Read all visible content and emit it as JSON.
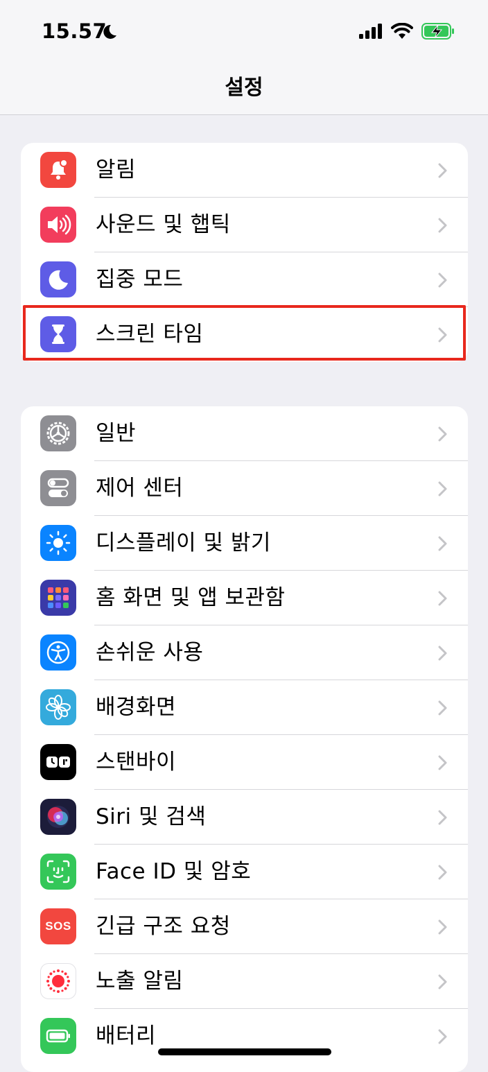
{
  "status_bar": {
    "time": "15.57"
  },
  "nav": {
    "title": "설정"
  },
  "groups": [
    {
      "items": [
        {
          "label": "알림",
          "icon": "bell-icon",
          "color": "#f2473f"
        },
        {
          "label": "사운드 및 햅틱",
          "icon": "speaker-icon",
          "color": "#f23d5c"
        },
        {
          "label": "집중 모드",
          "icon": "moon-icon",
          "color": "#5e5ce6"
        },
        {
          "label": "스크린 타임",
          "icon": "hourglass-icon",
          "color": "#5e5ce6",
          "highlighted": true
        }
      ]
    },
    {
      "items": [
        {
          "label": "일반",
          "icon": "gear-icon",
          "color": "#8e8e93"
        },
        {
          "label": "제어 센터",
          "icon": "toggles-icon",
          "color": "#8e8e93"
        },
        {
          "label": "디스플레이 및 밝기",
          "icon": "sun-icon",
          "color": "#0a84ff"
        },
        {
          "label": "홈 화면 및 앱 보관함",
          "icon": "app-grid-icon",
          "color": "#3a3aa8"
        },
        {
          "label": "손쉬운 사용",
          "icon": "accessibility-icon",
          "color": "#0a84ff"
        },
        {
          "label": "배경화면",
          "icon": "flower-icon",
          "color": "#34aadc"
        },
        {
          "label": "스탠바이",
          "icon": "standby-icon",
          "color": "#000000"
        },
        {
          "label": "Siri 및 검색",
          "icon": "siri-icon",
          "color": "#1c1c3a"
        },
        {
          "label": "Face ID 및 암호",
          "icon": "face-id-icon",
          "color": "#34c759"
        },
        {
          "label": "긴급 구조 요청",
          "icon": "sos-icon",
          "color": "#f2473f",
          "icon_text": "SOS"
        },
        {
          "label": "노출 알림",
          "icon": "exposure-icon",
          "color": "#ffffff"
        },
        {
          "label": "배터리",
          "icon": "battery-icon",
          "color": "#34c759"
        }
      ]
    }
  ]
}
